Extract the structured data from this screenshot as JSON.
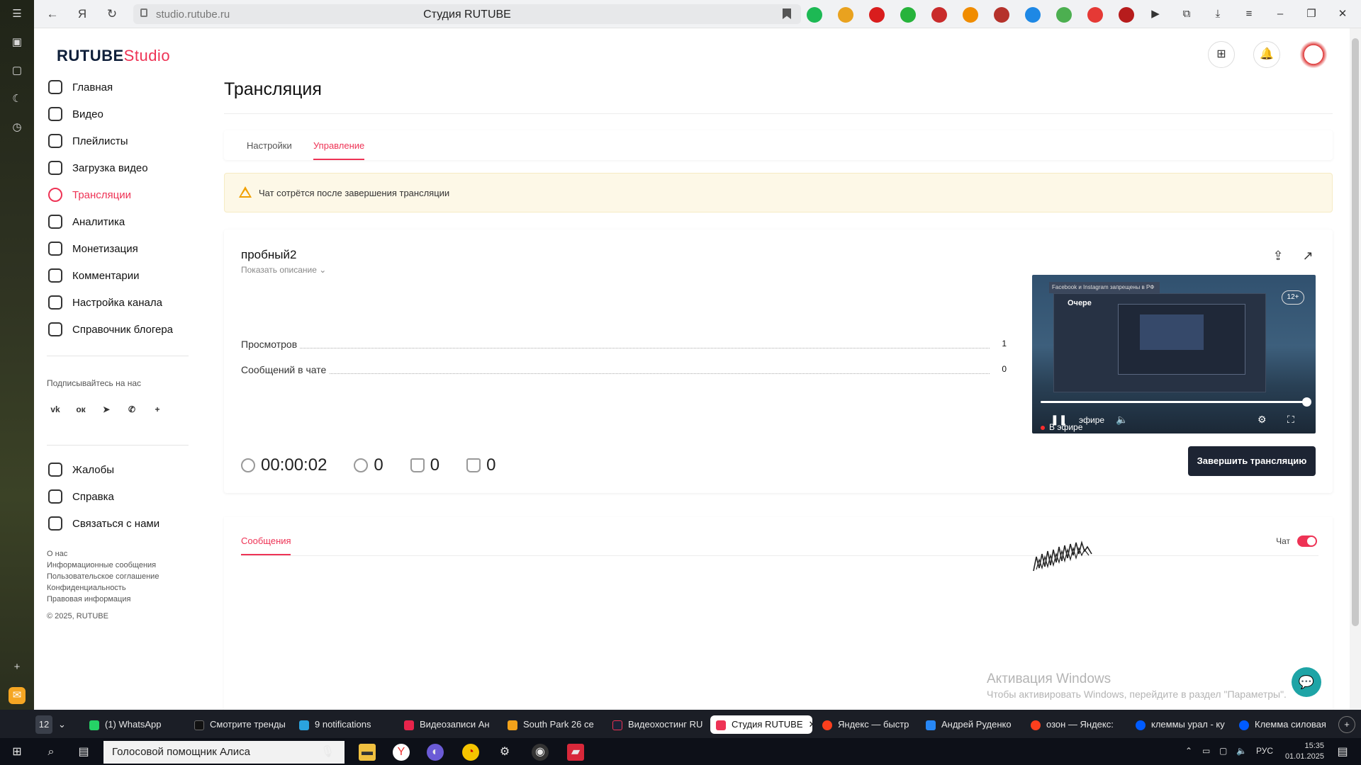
{
  "browser": {
    "url": "studio.rutube.ru",
    "page_title": "Студия RUTUBE"
  },
  "logo": {
    "rutube": "RUTUBE",
    "studio": "Studio"
  },
  "sidebar": {
    "items": [
      {
        "label": "Главная"
      },
      {
        "label": "Видео"
      },
      {
        "label": "Плейлисты"
      },
      {
        "label": "Загрузка видео"
      },
      {
        "label": "Трансляции"
      },
      {
        "label": "Аналитика"
      },
      {
        "label": "Монетизация"
      },
      {
        "label": "Комментарии"
      },
      {
        "label": "Настройка канала"
      },
      {
        "label": "Справочник блогера"
      }
    ],
    "subscribe_label": "Подписывайтесь на нас",
    "social": {
      "vk": "vk",
      "ok": "ок",
      "plus": "+"
    },
    "support_items": [
      {
        "label": "Жалобы"
      },
      {
        "label": "Справка"
      },
      {
        "label": "Связаться с нами"
      }
    ],
    "footer_links": [
      "О нас",
      "Информационные сообщения",
      "Пользовательское соглашение",
      "Конфиденциальность",
      "Правовая информация"
    ],
    "copyright": "© 2025, RUTUBE"
  },
  "main": {
    "title": "Трансляция",
    "tabs": [
      {
        "label": "Настройки"
      },
      {
        "label": "Управление"
      }
    ],
    "alert": "Чат сотрётся после завершения трансляции",
    "stream": {
      "name": "пробный2",
      "show_description": "Показать описание",
      "stats": [
        {
          "label": "Просмотров",
          "value": "1"
        },
        {
          "label": "Сообщений в чате",
          "value": "0"
        }
      ],
      "duration": "00:00:02",
      "viewers": "0",
      "likes": "0",
      "dislikes": "0",
      "end_button": "Завершить трансляцию"
    },
    "player": {
      "banner": "Facebook и Instagram запрещены в РФ",
      "inner_text": "Очере",
      "age_rating": "12+",
      "live_label": "В эфире",
      "live_label_behind": "эфире",
      "progress": 1.0
    },
    "messages": {
      "tab": "Сообщения",
      "chat_label": "Чат",
      "chat_enabled": true
    }
  },
  "windows_activation": {
    "title": "Активация Windows",
    "subtitle": "Чтобы активировать Windows, перейдите в раздел \"Параметры\"."
  },
  "browser_tabs": [
    {
      "label": "12",
      "color": "#3a3f4a"
    },
    {
      "label": "(1) WhatsApp",
      "color": "#25d366"
    },
    {
      "label": "Смотрите тренды",
      "color": "#111111"
    },
    {
      "label": "9 notifications",
      "color": "#2aa3de"
    },
    {
      "label": "Видеозаписи Ан",
      "color": "#e8244b"
    },
    {
      "label": "South Park 26 се",
      "color": "#f2a21b"
    },
    {
      "label": "Видеохостинг RU",
      "color": "#1a2236"
    },
    {
      "label": "Студия RUTUBE",
      "color": "#ee3355"
    },
    {
      "label": "Яндекс — быстр",
      "color": "#fc3f1d"
    },
    {
      "label": "Андрей Руденко",
      "color": "#2787f5"
    },
    {
      "label": "озон — Яндекс:",
      "color": "#fc3f1d"
    },
    {
      "label": "клеммы урал - ку",
      "color": "#005bff"
    },
    {
      "label": "Клемма силовая",
      "color": "#005bff"
    }
  ],
  "taskbar": {
    "search_placeholder": "Голосовой помощник Алиса",
    "lang": "РУС",
    "time": "15:35",
    "date": "01.01.2025"
  }
}
